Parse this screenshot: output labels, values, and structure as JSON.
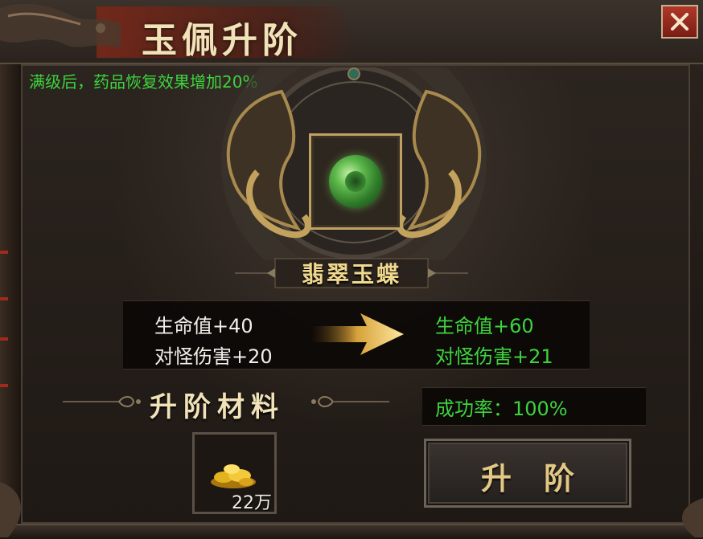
{
  "window": {
    "title": "玉佩升阶",
    "close_icon": "close-icon"
  },
  "hint_text": "满级后，药品恢复效果增加20%",
  "item": {
    "name": "翡翠玉蝶",
    "icon": "jade-pendant-icon"
  },
  "stats": {
    "current": [
      "生命值+40",
      "对怪伤害+20"
    ],
    "next": [
      "生命值+60",
      "对怪伤害+21"
    ]
  },
  "materials": {
    "title": "升阶材料",
    "items": [
      {
        "icon": "gold-coins-icon",
        "count": "22万"
      }
    ]
  },
  "success_rate": "成功率：100%",
  "upgrade_button": {
    "label": "升阶"
  },
  "colors": {
    "accent_green": "#3ed33e",
    "gold_text": "#f1e2b8",
    "close_red": "#b0382a"
  }
}
